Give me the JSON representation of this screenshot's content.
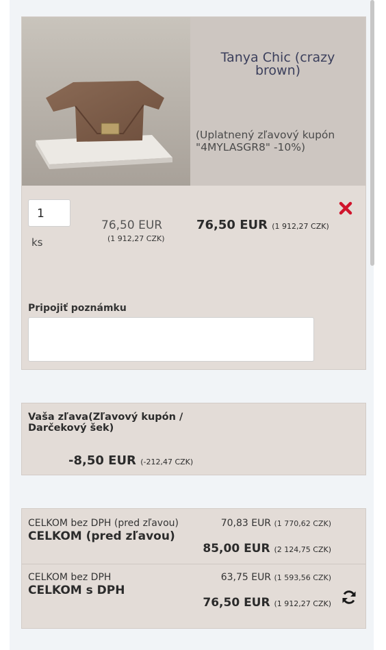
{
  "product": {
    "title": "Tanya Chic (crazy brown)",
    "coupon_note": "(Uplatnený zľavový kupón \"4MYLASGR8\" -10%)",
    "quantity": "1",
    "unit": "ks",
    "unit_price": "76,50 EUR",
    "unit_price_czk": "(1 912,27 CZK)",
    "total_price": "76,50 EUR",
    "total_price_czk": "(1 912,27 CZK)",
    "note_label": "Pripojiť poznámku",
    "note_value": ""
  },
  "discount": {
    "title": "Vaša zľava(Zľavový kupón / Darčekový šek)",
    "value": "-8,50 EUR",
    "value_czk": "(-212,47 CZK)"
  },
  "totals": {
    "before_discount": {
      "net_label": "CELKOM bez DPH (pred zľavou)",
      "net_value": "70,83 EUR",
      "net_czk": "(1 770,62 CZK)",
      "gross_label": "CELKOM (pred zľavou)",
      "gross_value": "85,00 EUR",
      "gross_czk": "(2 124,75 CZK)"
    },
    "after_discount": {
      "net_label": "CELKOM bez DPH",
      "net_value": "63,75 EUR",
      "net_czk": "(1 593,56 CZK)",
      "gross_label": "CELKOM s DPH",
      "gross_value": "76,50 EUR",
      "gross_czk": "(1 912,27 CZK)"
    }
  },
  "icons": {
    "remove": "close-icon",
    "refresh": "refresh-icon"
  },
  "colors": {
    "remove": "#d0142c",
    "title": "#3b3f5c",
    "box_bg": "#e3dcd7"
  }
}
